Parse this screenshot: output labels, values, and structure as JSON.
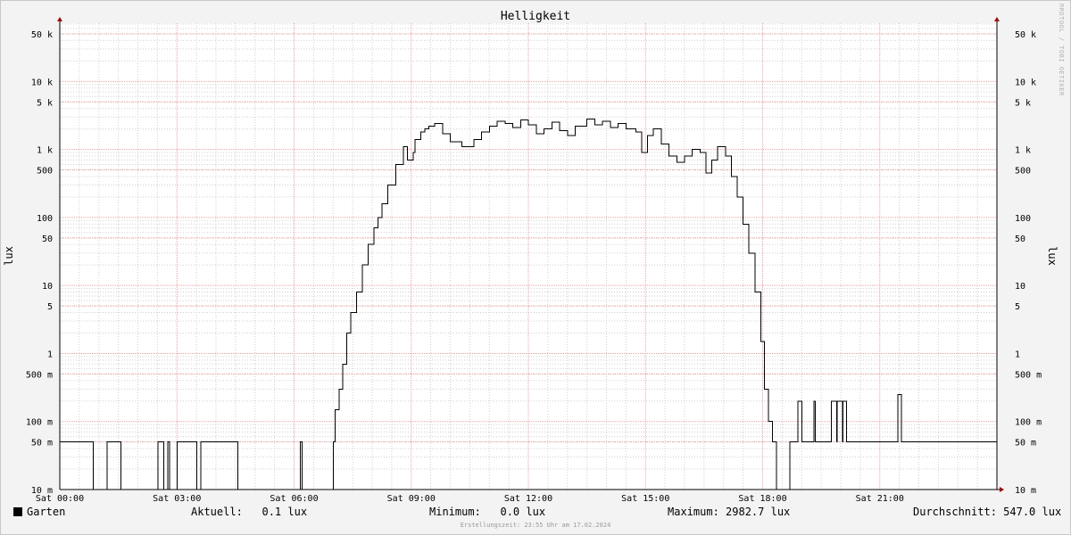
{
  "chart_data": {
    "type": "line",
    "title": "Helligkeit",
    "ylabel": "lux",
    "yscale": "log",
    "ylim": [
      0.01,
      70000
    ],
    "xlim": [
      "Sat 00:00",
      "Sat 24:00"
    ],
    "x_tick_labels": [
      "Sat 00:00",
      "Sat 03:00",
      "Sat 06:00",
      "Sat 09:00",
      "Sat 12:00",
      "Sat 15:00",
      "Sat 18:00",
      "Sat 21:00"
    ],
    "y_tick_labels": [
      "10 m",
      "50 m",
      "100 m",
      "500 m",
      "1",
      "5",
      "10",
      "50",
      "100",
      "500",
      "1 k",
      "5 k",
      "10 k",
      "50 k"
    ],
    "y_tick_values": [
      0.01,
      0.05,
      0.1,
      0.5,
      1,
      5,
      10,
      50,
      100,
      500,
      1000,
      5000,
      10000,
      50000
    ],
    "grid": true,
    "series": [
      {
        "name": "Garten",
        "color": "#000000",
        "x_hours": [
          0,
          0.85,
          0.86,
          1.2,
          1.21,
          1.55,
          1.56,
          2.5,
          2.51,
          2.65,
          2.66,
          2.75,
          2.76,
          2.8,
          2.81,
          3.0,
          3.01,
          3.5,
          3.51,
          3.6,
          3.61,
          4.55,
          4.56,
          6.15,
          6.16,
          6.2,
          6.21,
          7.0,
          7.05,
          7.15,
          7.25,
          7.35,
          7.45,
          7.6,
          7.75,
          7.9,
          8.05,
          8.15,
          8.25,
          8.4,
          8.6,
          8.8,
          8.9,
          9.05,
          9.1,
          9.25,
          9.35,
          9.45,
          9.6,
          9.8,
          10.0,
          10.3,
          10.6,
          10.8,
          11.0,
          11.2,
          11.4,
          11.6,
          11.8,
          12.0,
          12.2,
          12.4,
          12.6,
          12.8,
          13.0,
          13.2,
          13.5,
          13.7,
          13.9,
          14.1,
          14.3,
          14.5,
          14.75,
          14.9,
          15.05,
          15.2,
          15.4,
          15.6,
          15.8,
          16.0,
          16.2,
          16.4,
          16.55,
          16.7,
          16.85,
          17.05,
          17.2,
          17.35,
          17.5,
          17.65,
          17.8,
          17.95,
          18.05,
          18.15,
          18.25,
          18.35,
          18.45,
          18.55,
          18.6,
          18.7,
          18.75,
          18.8,
          18.9,
          19.0,
          19.01,
          19.05,
          19.3,
          19.31,
          19.35,
          19.36,
          19.6,
          19.61,
          19.75,
          19.76,
          19.9,
          19.91,
          20.05,
          20.06,
          20.15,
          20.16,
          20.25,
          20.26,
          20.3,
          20.31,
          20.55,
          20.56,
          21.45,
          21.46,
          21.55,
          21.56,
          24.0
        ],
        "values": [
          0.05,
          0.05,
          0.01,
          0.01,
          0.05,
          0.05,
          0.01,
          0.01,
          0.05,
          0.05,
          0.01,
          0.01,
          0.05,
          0.05,
          0.01,
          0.01,
          0.05,
          0.05,
          0.01,
          0.01,
          0.05,
          0.05,
          0.01,
          0.01,
          0.05,
          0.05,
          0.01,
          0.05,
          0.15,
          0.3,
          0.7,
          2,
          4,
          8,
          20,
          40,
          70,
          100,
          160,
          300,
          600,
          1100,
          700,
          900,
          1400,
          1800,
          2000,
          2200,
          2400,
          1700,
          1300,
          1100,
          1400,
          1800,
          2200,
          2600,
          2400,
          2100,
          2700,
          2300,
          1700,
          2000,
          2500,
          1900,
          1600,
          2200,
          2800,
          2300,
          2600,
          2100,
          2400,
          2000,
          1800,
          900,
          1600,
          2000,
          1200,
          800,
          650,
          800,
          1000,
          900,
          450,
          700,
          1100,
          800,
          400,
          200,
          80,
          30,
          8,
          1.5,
          0.3,
          0.1,
          0.05,
          0.01,
          0.01,
          0.01,
          0.01,
          0.05,
          0.05,
          0.05,
          0.2,
          0.05,
          0.05,
          0.05,
          0.05,
          0.2,
          0.05,
          0.05,
          0.05,
          0.05,
          0.05,
          0.2,
          0.05,
          0.2,
          0.05,
          0.2,
          0.05,
          0.05,
          0.05,
          0.05,
          0.05,
          0.05,
          0.05,
          0.05,
          0.05,
          0.25,
          0.05,
          0.05,
          0.05
        ]
      }
    ]
  },
  "legend": {
    "series_name": "Garten",
    "aktuell": "Aktuell:   0.1 lux",
    "minimum": "Minimum:   0.0 lux",
    "maximum": "Maximum: 2982.7 lux",
    "durchschnitt": "Durchschnitt: 547.0 lux"
  },
  "footer": "Erstellungszeit: 23:55 Uhr am 17.02.2024",
  "watermark": "RRDTOOL / TOBI OETIKER",
  "colors": {
    "background": "#f3f3f3",
    "plot_background": "#ffffff",
    "major_grid": "#e8a0a0",
    "minor_grid": "#cfcfcf",
    "series": "#000000",
    "axis_arrow": "#a00000"
  }
}
